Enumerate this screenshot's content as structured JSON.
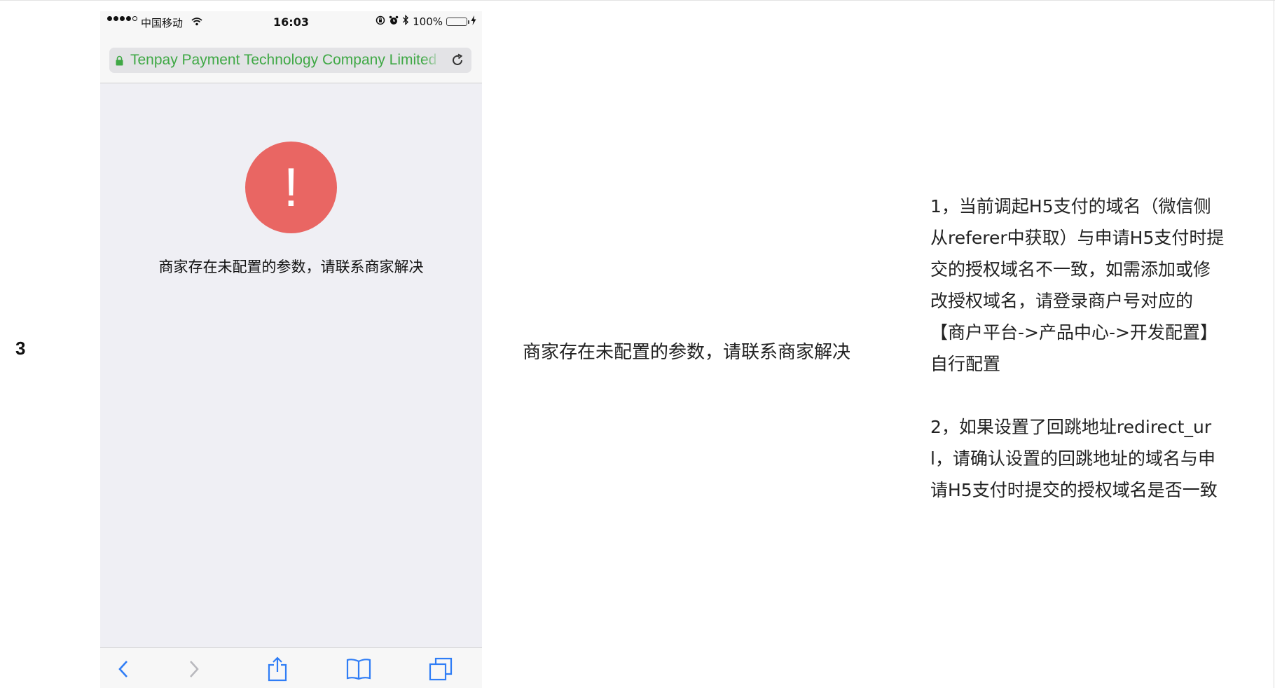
{
  "row": {
    "number": "3"
  },
  "phone": {
    "status_bar": {
      "carrier": "中国移动",
      "time": "16:03",
      "battery": "100%",
      "battery_level": 1.0,
      "signal_bars_filled": 4,
      "signal_bars_total": 5
    },
    "url_bar": {
      "text": "Tenpay Payment Technology Company Limited",
      "text_color": "#3fa845"
    },
    "alert": {
      "symbol": "!",
      "color": "#e96663",
      "message": "商家存在未配置的参数，请联系商家解决"
    },
    "toolbar": {
      "icons": [
        "back-icon",
        "forward-icon",
        "share-icon",
        "bookmarks-icon",
        "tabs-icon"
      ]
    }
  },
  "error_description": "商家存在未配置的参数，请联系商家解决",
  "solution": {
    "lines_1": [
      "1，当前调起H5支付的域名（微信侧",
      "从referer中获取）与申请H5支付时提",
      "交的授权域名不一致，如需添加或修",
      "改授权域名，请登录商户号对应的",
      "【商户平台->产品中心->开发配置】",
      "自行配置"
    ],
    "lines_2": [
      "2，如果设置了回跳地址redirect_ur",
      "l，请确认设置的回跳地址的域名与申",
      "请H5支付时提交的授权域名是否一致"
    ]
  }
}
